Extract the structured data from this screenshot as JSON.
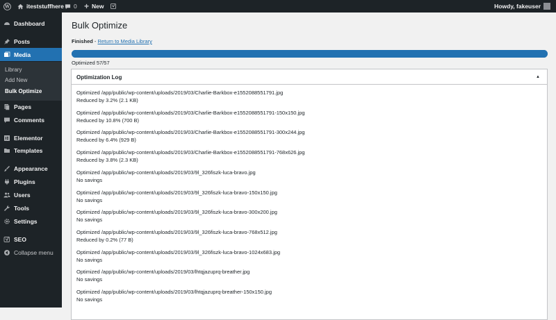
{
  "adminbar": {
    "site_name": "iteststuffhere",
    "comments_count": "0",
    "new_label": "New",
    "howdy": "Howdy, fakeuser"
  },
  "sidebar": {
    "items": [
      {
        "label": "Dashboard",
        "icon": "dashboard-icon"
      },
      {
        "label": "Posts",
        "icon": "pin-icon"
      },
      {
        "label": "Media",
        "icon": "media-icon",
        "active": true
      },
      {
        "label": "Pages",
        "icon": "pages-icon"
      },
      {
        "label": "Comments",
        "icon": "comments-icon"
      },
      {
        "label": "Elementor",
        "icon": "elementor-icon"
      },
      {
        "label": "Templates",
        "icon": "folder-icon"
      },
      {
        "label": "Appearance",
        "icon": "paintbrush-icon"
      },
      {
        "label": "Plugins",
        "icon": "plug-icon"
      },
      {
        "label": "Users",
        "icon": "users-icon"
      },
      {
        "label": "Tools",
        "icon": "wrench-icon"
      },
      {
        "label": "Settings",
        "icon": "settings-icon"
      },
      {
        "label": "SEO",
        "icon": "yoast-icon"
      },
      {
        "label": "Collapse menu",
        "icon": "collapse-icon"
      }
    ],
    "submenu": [
      "Library",
      "Add New",
      "Bulk Optimize"
    ]
  },
  "main": {
    "title": "Bulk Optimize",
    "finished": "Finished",
    "separator": " - ",
    "return_link": "Return to Media Library",
    "progress_percent": 100,
    "progress_text": "Optimized 57/57",
    "log_title": "Optimization Log",
    "log_toggle": "▲",
    "log_entries": [
      {
        "path": "Optimized /app/public/wp-content/uploads/2019/03/Charlie-Barkbox-e1552088551791.jpg",
        "result": "Reduced by 3.2% (2.1 KB)"
      },
      {
        "path": "Optimized /app/public/wp-content/uploads/2019/03/Charlie-Barkbox-e1552088551791-150x150.jpg",
        "result": "Reduced by 10.8% (700 B)"
      },
      {
        "path": "Optimized /app/public/wp-content/uploads/2019/03/Charlie-Barkbox-e1552088551791-300x244.jpg",
        "result": "Reduced by 6.4% (929 B)"
      },
      {
        "path": "Optimized /app/public/wp-content/uploads/2019/03/Charlie-Barkbox-e1552088551791-768x626.jpg",
        "result": "Reduced by 3.8% (2.3 KB)"
      },
      {
        "path": "Optimized /app/public/wp-content/uploads/2019/03/9l_326fiszk-luca-bravo.jpg",
        "result": "No savings"
      },
      {
        "path": "Optimized /app/public/wp-content/uploads/2019/03/9l_326fiszk-luca-bravo-150x150.jpg",
        "result": "No savings"
      },
      {
        "path": "Optimized /app/public/wp-content/uploads/2019/03/9l_326fiszk-luca-bravo-300x200.jpg",
        "result": "No savings"
      },
      {
        "path": "Optimized /app/public/wp-content/uploads/2019/03/9l_326fiszk-luca-bravo-768x512.jpg",
        "result": "Reduced by 0.2% (77 B)"
      },
      {
        "path": "Optimized /app/public/wp-content/uploads/2019/03/9l_326fiszk-luca-bravo-1024x683.jpg",
        "result": "No savings"
      },
      {
        "path": "Optimized /app/public/wp-content/uploads/2019/03/lhtqjazuprq-breather.jpg",
        "result": "No savings"
      },
      {
        "path": "Optimized /app/public/wp-content/uploads/2019/03/lhtqjazuprq-breather-150x150.jpg",
        "result": "No savings"
      }
    ]
  },
  "colors": {
    "accent": "#2271b1",
    "sidebar_bg": "#1d2327",
    "submenu_bg": "#2c3338"
  }
}
